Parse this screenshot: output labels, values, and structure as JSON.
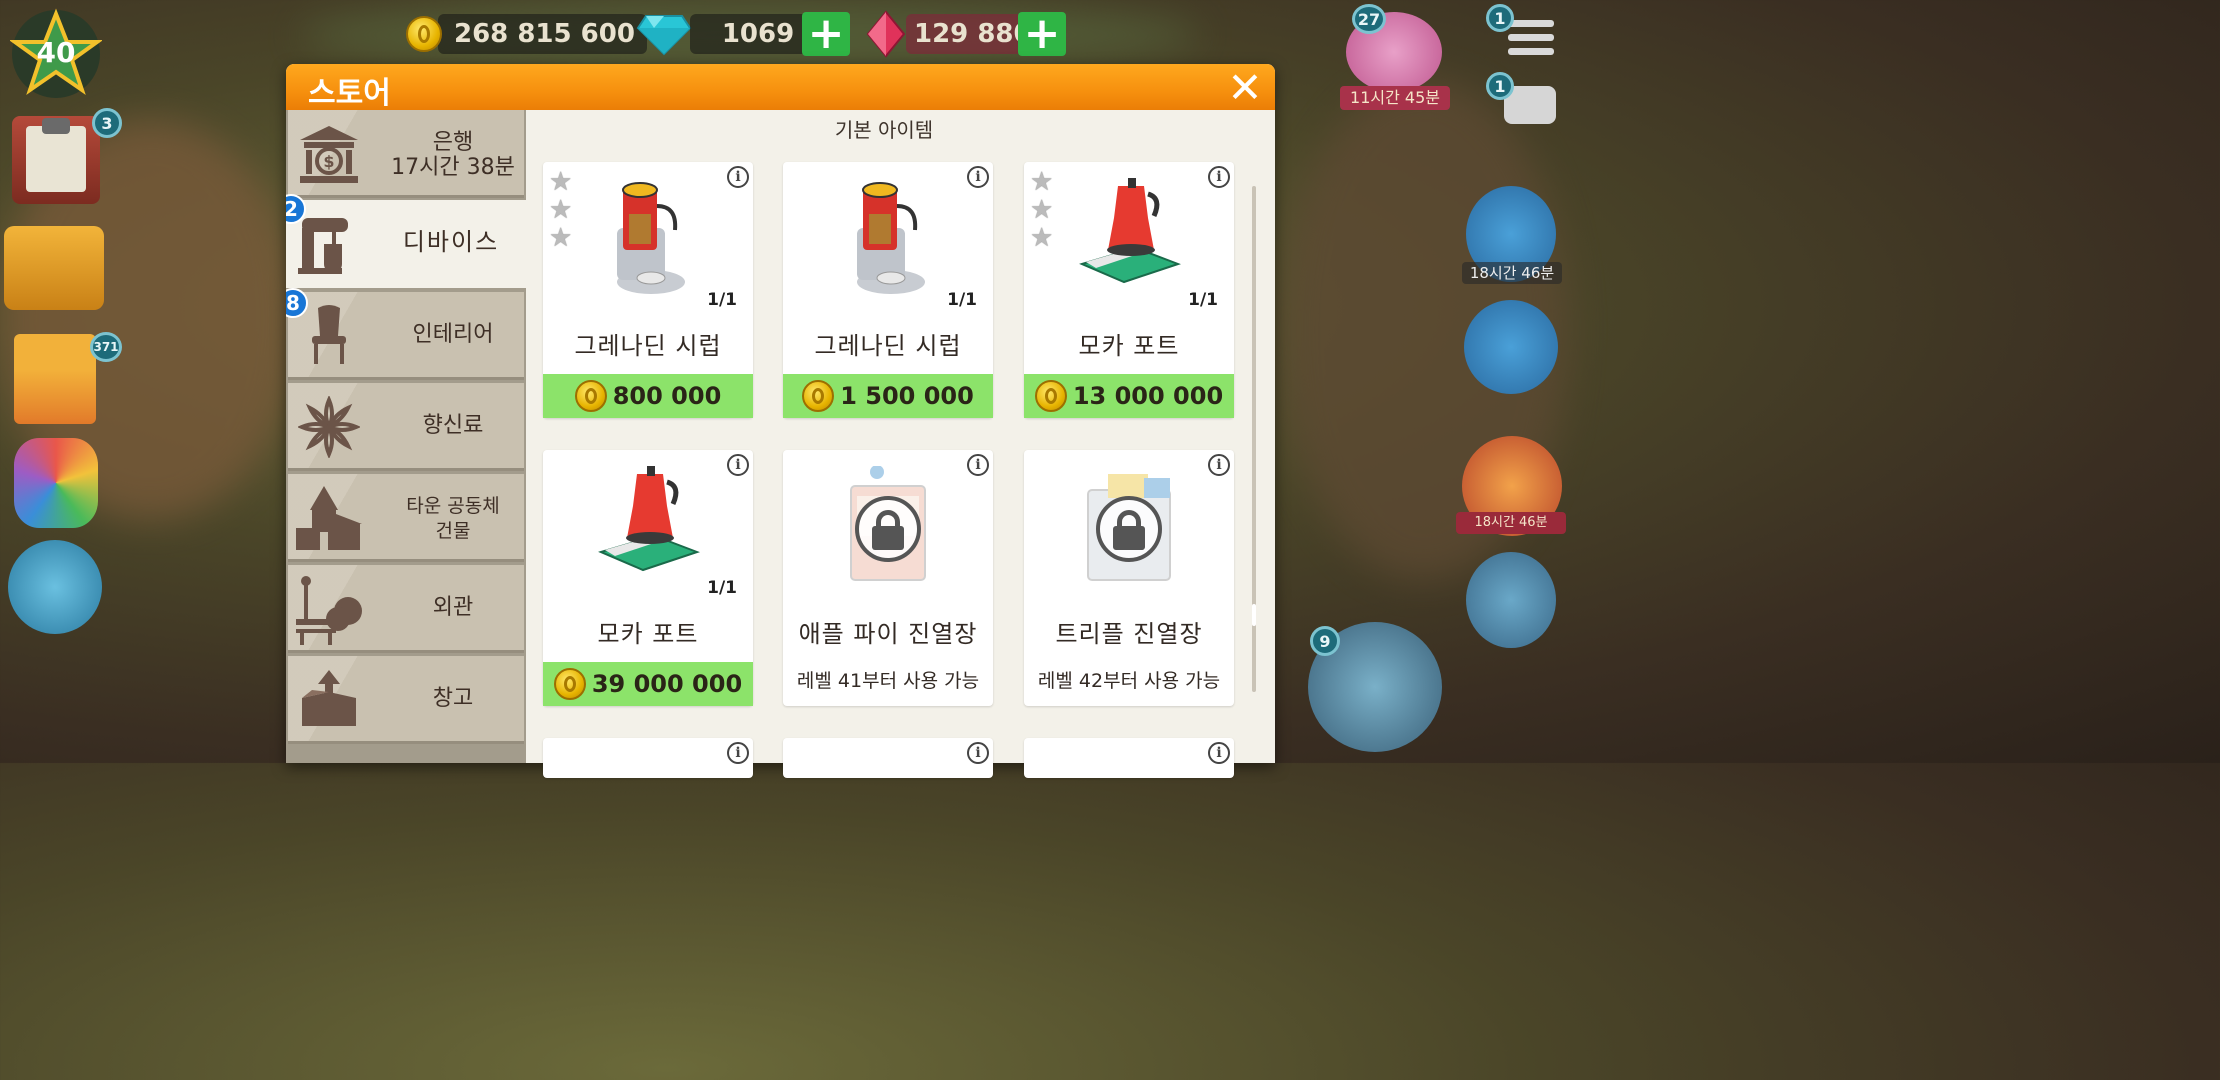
{
  "hud": {
    "level": "40",
    "coins": "268 815 600",
    "diamonds": "1069",
    "rubies": "129 880",
    "plus_symbol": "+"
  },
  "left_side": {
    "tasks_badge": "3",
    "gift_badge": "371"
  },
  "right_side": {
    "menu_badge": "1",
    "chat_badge": "1",
    "event_badge": "27",
    "event_timer": "11시간 45분",
    "gift_timer": "18시간 46분",
    "balloon_timer": "18시간 46분",
    "register_badge": "9"
  },
  "store": {
    "title": "스토어",
    "close_symbol": "✕",
    "section_title": "기본 아이템",
    "categories": [
      {
        "label": "은행",
        "sublabel": "17시간 38분",
        "icon": "bank-icon",
        "badge": ""
      },
      {
        "label": "디바이스",
        "sublabel": "",
        "icon": "mixer-icon",
        "badge": "2"
      },
      {
        "label": "인테리어",
        "sublabel": "",
        "icon": "chair-icon",
        "badge": "8"
      },
      {
        "label": "향신료",
        "sublabel": "",
        "icon": "star-anise-icon",
        "badge": ""
      },
      {
        "label": "타운 공동체",
        "sublabel": "건물",
        "icon": "church-icon",
        "badge": ""
      },
      {
        "label": "외관",
        "sublabel": "",
        "icon": "bench-icon",
        "badge": ""
      },
      {
        "label": "창고",
        "sublabel": "",
        "icon": "box-icon",
        "badge": ""
      }
    ],
    "items": [
      {
        "name": "그레나딘 시럽",
        "count": "1/1",
        "price": "800 000",
        "unlock": "",
        "icon": "syrup-dispenser-icon"
      },
      {
        "name": "그레나딘 시럽",
        "count": "1/1",
        "price": "1 500 000",
        "unlock": "",
        "icon": "syrup-dispenser-icon"
      },
      {
        "name": "모카 포트",
        "count": "1/1",
        "price": "13 000 000",
        "unlock": "",
        "icon": "moka-pot-icon"
      },
      {
        "name": "모카 포트",
        "count": "1/1",
        "price": "39 000 000",
        "unlock": "",
        "icon": "moka-pot-icon"
      },
      {
        "name": "애플 파이 진열장",
        "count": "",
        "price": "",
        "unlock": "레벨 41부터 사용 가능",
        "icon": "lock-icon"
      },
      {
        "name": "트리플 진열장",
        "count": "",
        "price": "",
        "unlock": "레벨 42부터 사용 가능",
        "icon": "lock-icon"
      }
    ],
    "info_symbol": "i",
    "star_symbol": "★"
  },
  "colors": {
    "header_orange": "#f6900e",
    "price_green": "#8ce36a",
    "plus_green": "#2fb545",
    "badge_blue": "#1876d6"
  }
}
